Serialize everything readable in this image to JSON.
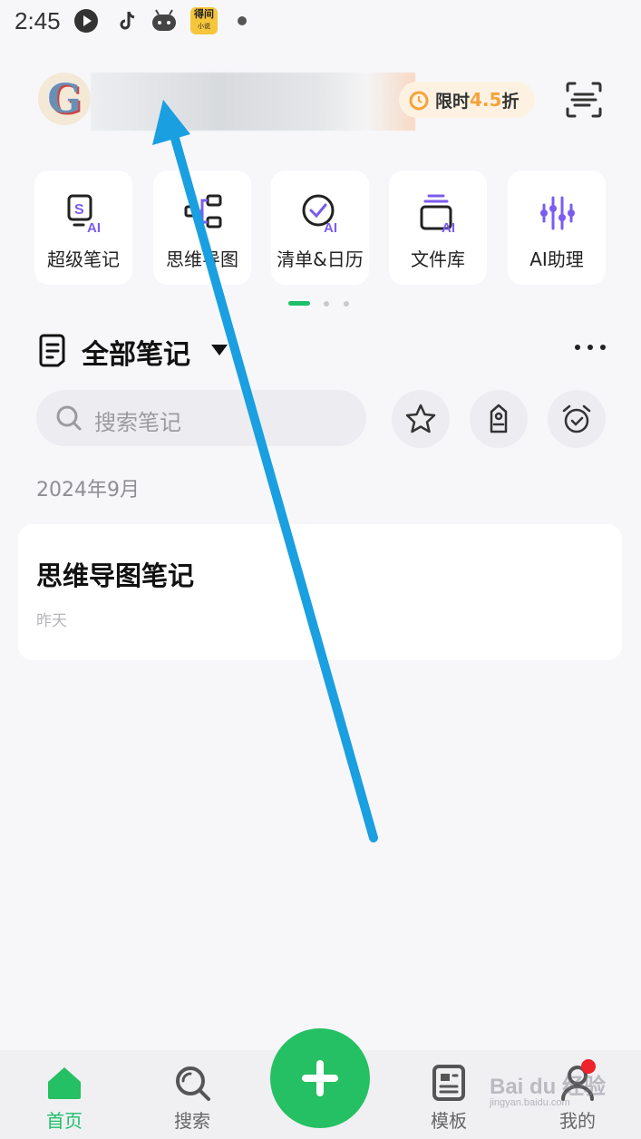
{
  "status_bar": {
    "time": "2:45",
    "icons": [
      "video-app-icon",
      "tiktok-icon",
      "game-icon",
      "novel-app-icon"
    ],
    "novel_app_label": "得间",
    "novel_app_sub": "小说"
  },
  "header": {
    "avatar_letter": "G",
    "promo": {
      "prefix": "限时",
      "value": "4.5",
      "suffix": "折"
    },
    "scan_icon": "scan-icon"
  },
  "tiles": [
    {
      "label": "超级笔记",
      "icon": "super-note-ai-icon"
    },
    {
      "label": "思维导图",
      "icon": "mindmap-icon"
    },
    {
      "label": "清单&日历",
      "icon": "checklist-ai-icon"
    },
    {
      "label": "文件库",
      "icon": "file-library-ai-icon"
    },
    {
      "label": "AI助理",
      "icon": "ai-assistant-icon"
    }
  ],
  "pager": {
    "active": 1,
    "total": 3
  },
  "section": {
    "title": "全部笔记"
  },
  "search": {
    "placeholder": "搜索笔记"
  },
  "date_group": "2024年9月",
  "notes": [
    {
      "title": "思维导图笔记",
      "time": "昨天"
    }
  ],
  "bottom_nav": {
    "items": [
      {
        "label": "首页",
        "icon": "home-icon",
        "active": true
      },
      {
        "label": "搜索",
        "icon": "search-icon",
        "active": false
      },
      {
        "label": "模板",
        "icon": "template-icon",
        "active": false
      },
      {
        "label": "我的",
        "icon": "profile-icon",
        "active": false
      }
    ],
    "add_icon": "plus-icon"
  },
  "watermark": {
    "main": "Bai du 经验",
    "sub": "jingyan.baidu.com"
  },
  "colors": {
    "accent": "#25c063",
    "accent_text": "#1dbf69",
    "promo": "#f5a33b",
    "ai_purple": "#7b5cf0",
    "annotation_arrow": "#1a9fe0",
    "badge_red": "#f0222a"
  }
}
